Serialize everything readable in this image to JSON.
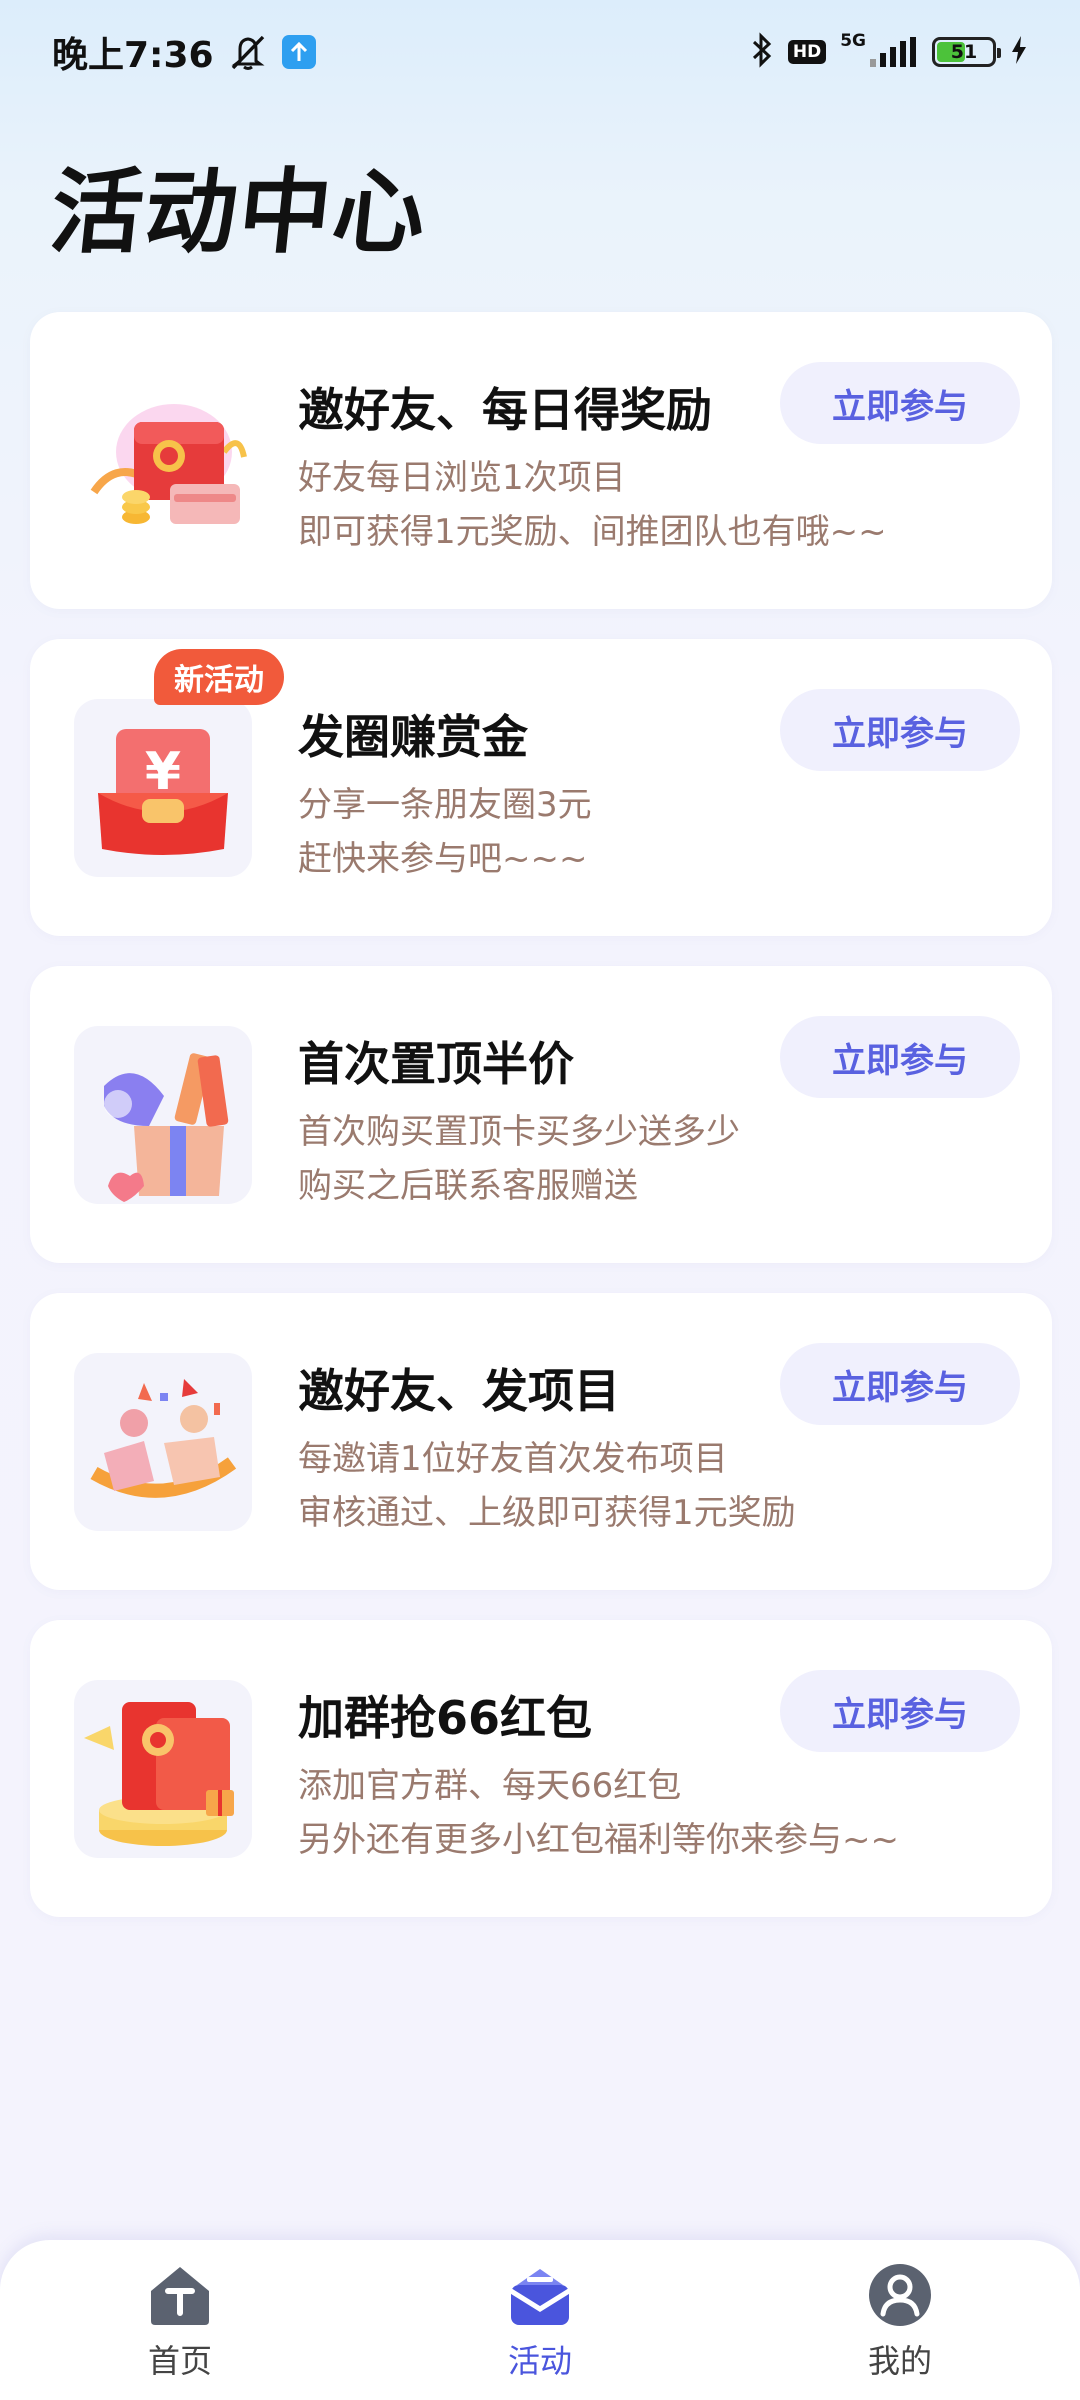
{
  "status_bar": {
    "time": "晚上7:36",
    "hd": "HD",
    "network": "5G",
    "battery": "51",
    "battery_level": 0.51
  },
  "page": {
    "title": "活动中心"
  },
  "cards": [
    {
      "title": "邀好友、每日得奖励",
      "line1": "好友每日浏览1次项目",
      "line2": "即可获得1元奖励、间推团队也有哦~~",
      "button": "立即参与",
      "icon": "red-envelope-gift-icon"
    },
    {
      "badge": "新活动",
      "title": "发圈赚赏金",
      "line1": "分享一条朋友圈3元",
      "line2": "赶快来参与吧~~~",
      "button": "立即参与",
      "icon": "yuan-red-envelope-icon"
    },
    {
      "title": "首次置顶半价",
      "line1": "首次购买置顶卡买多少送多少",
      "line2": "购买之后联系客服赠送",
      "button": "立即参与",
      "icon": "gift-box-tickets-icon"
    },
    {
      "title": "邀好友、发项目",
      "line1": "每邀请1位好友首次发布项目",
      "line2": "审核通过、上级即可获得1元奖励",
      "button": "立即参与",
      "icon": "friends-cheering-icon"
    },
    {
      "title": "加群抢66红包",
      "line1": "添加官方群、每天66红包",
      "line2": "另外还有更多小红包福利等你来参与~~",
      "button": "立即参与",
      "icon": "red-envelope-podium-icon"
    }
  ],
  "bottom_nav": {
    "items": [
      {
        "label": "首页",
        "icon": "home-icon",
        "active": false
      },
      {
        "label": "活动",
        "icon": "activity-icon",
        "active": true
      },
      {
        "label": "我的",
        "icon": "profile-icon",
        "active": false
      }
    ]
  },
  "colors": {
    "accent": "#5961e0",
    "badge": "#f15a3b",
    "subtext": "#9a7a6e"
  }
}
